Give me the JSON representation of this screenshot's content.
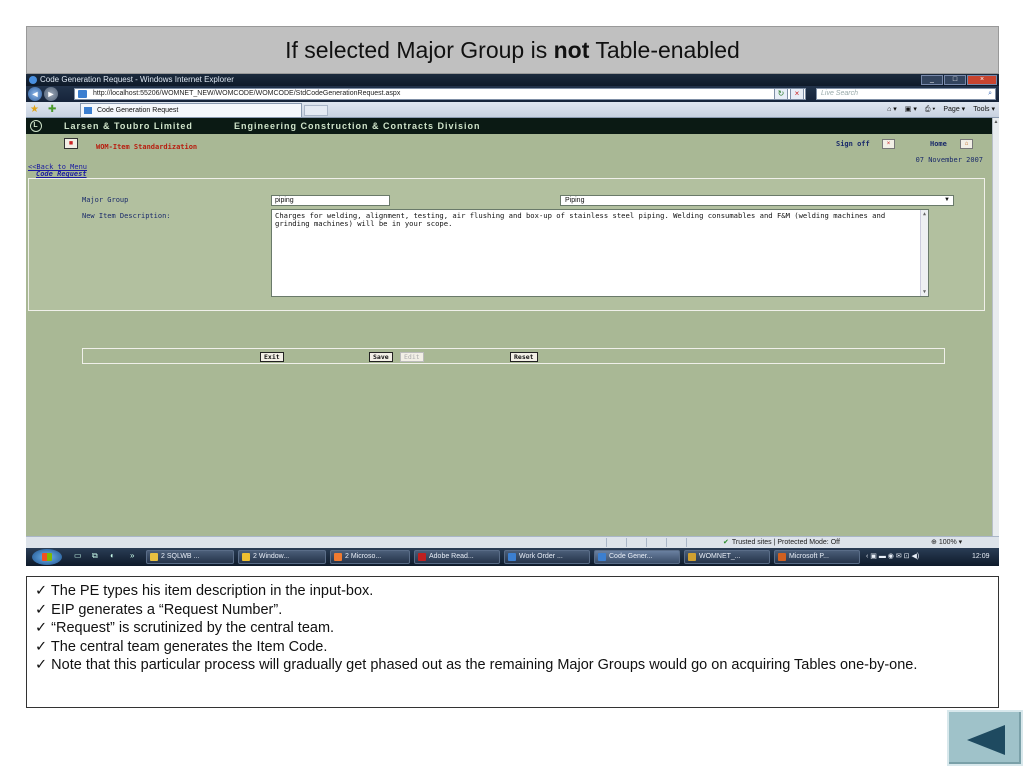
{
  "slide": {
    "title_pre": "If selected Major Group is ",
    "title_bold": "not",
    "title_post": " Table-enabled"
  },
  "browser": {
    "window_title": "Code Generation Request - Windows Internet Explorer",
    "url": "http://localhost:55206/WOMNET_NEW/WOMCODE/WOMCODE/StdCodeGenerationRequest.aspx",
    "search_placeholder": "Live Search",
    "tab_label": "Code Generation Request",
    "command_items": [
      "Page ▾",
      "Tools ▾"
    ],
    "status_zone": "Trusted sites | Protected Mode: Off",
    "zoom": "100%"
  },
  "app": {
    "company": "Larsen & Toubro Limited",
    "division": "Engineering Construction & Contracts Division",
    "module_title": "WOM-Item Standardization",
    "sign_off": "Sign off",
    "home": "Home",
    "date": "07 November 2007",
    "back_link": "<<Back to Menu",
    "section_title": "Code Request",
    "form": {
      "major_group_label": "Major Group",
      "major_group_value": "piping",
      "major_group_select": "Piping",
      "description_label": "New Item Description:",
      "description_value": "Charges for welding, alignment, testing, air flushing and box-up of stainless steel piping. Welding consumables and F&M (welding machines and grinding machines) will be in your scope."
    },
    "buttons": {
      "exit": "Exit",
      "save": "Save",
      "edit": "Edit",
      "reset": "Reset"
    }
  },
  "taskbar": {
    "tasks": [
      {
        "label": "2 SQLWB ...",
        "color": "#e8c040"
      },
      {
        "label": "2 Window...",
        "color": "#f0c030"
      },
      {
        "label": "2 Microso...",
        "color": "#f07a30"
      },
      {
        "label": "Adobe Read...",
        "color": "#c02020"
      },
      {
        "label": "Work Order ...",
        "color": "#3c7fd0"
      },
      {
        "label": "Code Gener...",
        "color": "#3c7fd0"
      },
      {
        "label": "WOMNET_...",
        "color": "#d0a030"
      },
      {
        "label": "Microsoft P...",
        "color": "#d06020"
      }
    ],
    "clock": "12:09"
  },
  "notes": [
    "✓ The PE types his item description in the input-box.",
    "✓ EIP generates a “Request Number”.",
    "✓ “Request” is scrutinized by the central team.",
    "✓ The central team generates the Item Code.",
    "✓ Note that this particular process will gradually get phased out as the remaining Major Groups would go on acquiring Tables one-by-one."
  ],
  "colors": {
    "app_background": "#a9b895",
    "header_dark": "#0b1a14",
    "module_title": "#b81d0f",
    "link_blue": "#1a1aa0"
  }
}
